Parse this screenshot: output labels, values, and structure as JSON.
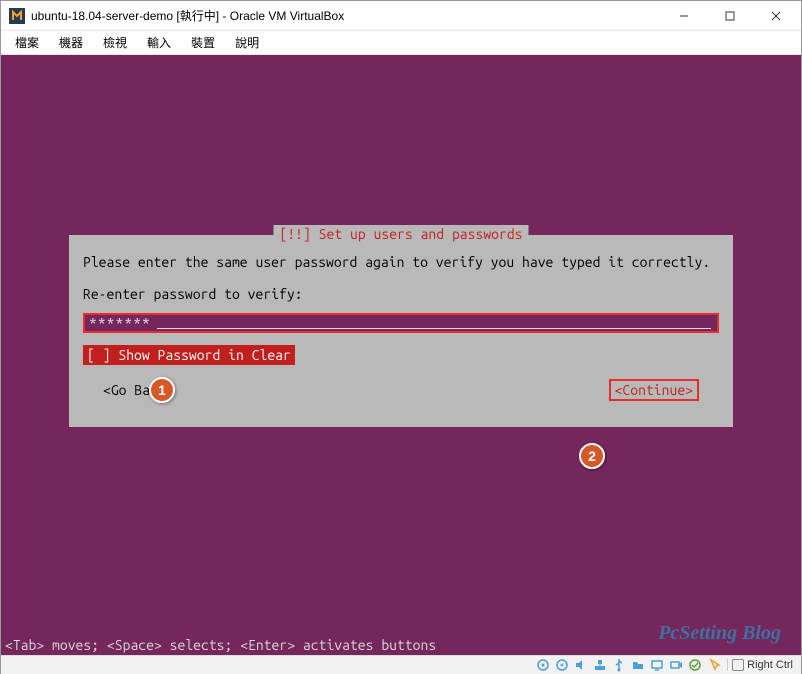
{
  "window": {
    "title": "ubuntu-18.04-server-demo [執行中] - Oracle VM VirtualBox"
  },
  "menu": {
    "items": [
      "檔案",
      "機器",
      "檢視",
      "輸入",
      "裝置",
      "說明"
    ]
  },
  "dialog": {
    "title": "[!!] Set up users and passwords",
    "instruction": "Please enter the same user password again to verify you have typed it correctly.",
    "prompt": "Re-enter password to verify:",
    "password_masked": "*******",
    "checkbox_label": "[ ] Show Password in Clear",
    "go_back": "<Go Back>",
    "continue": "<Continue>"
  },
  "annotations": {
    "one": "1",
    "two": "2"
  },
  "helpbar": "<Tab> moves; <Space> selects; <Enter> activates buttons",
  "watermark": "PcSetting Blog",
  "statusbar": {
    "host_key": "Right Ctrl"
  }
}
